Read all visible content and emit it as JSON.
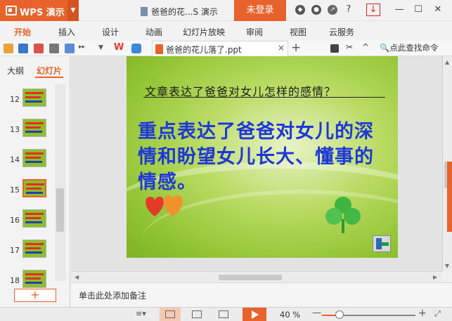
{
  "app": {
    "name": "WPS 演示",
    "window_title": "爸爸的花...S 演示",
    "login_label": "未登录"
  },
  "menu": {
    "tabs": [
      "开始",
      "插入",
      "设计",
      "动画",
      "幻灯片放映",
      "审阅",
      "视图",
      "云服务"
    ],
    "active": 0
  },
  "doc_tab": {
    "name": "爸爸的花儿落了.ppt",
    "close": "×",
    "add": "+"
  },
  "search": {
    "label": "点此查找命令"
  },
  "left_panel": {
    "tabs": [
      "大纲",
      "幻灯片"
    ],
    "active_tab": 1,
    "thumbnails": [
      {
        "num": "12",
        "selected": false
      },
      {
        "num": "13",
        "selected": false
      },
      {
        "num": "14",
        "selected": false
      },
      {
        "num": "15",
        "selected": true
      },
      {
        "num": "16",
        "selected": false
      },
      {
        "num": "17",
        "selected": false
      },
      {
        "num": "18",
        "selected": false
      }
    ],
    "add_label": "+"
  },
  "slide": {
    "title": "文章表达了爸爸对女儿怎样的感情？",
    "body": "重点表达了爸爸对女儿的深情和盼望女儿长大、懂事的情感。"
  },
  "notes": {
    "placeholder": "单击此处添加备注"
  },
  "status": {
    "zoom_label": "40 %",
    "zoom_value": 0.4,
    "colors": {
      "accent": "#e8622c",
      "slide_bg": "#8ec22f",
      "body_text": "#1f37d6"
    }
  }
}
